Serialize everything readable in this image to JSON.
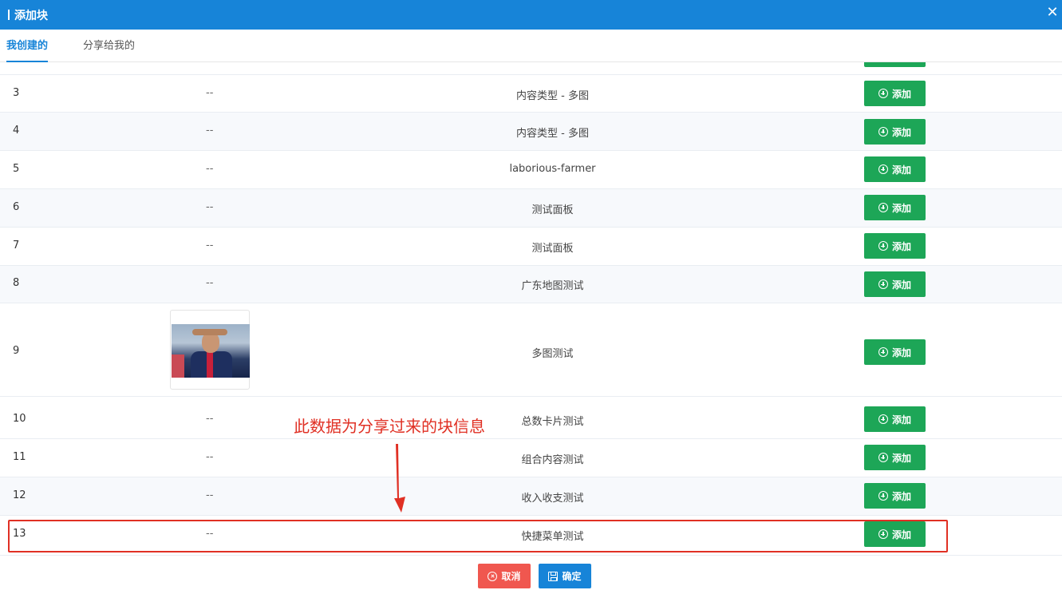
{
  "dialog": {
    "title": "添加块",
    "close_icon": "close-icon",
    "tabs": [
      {
        "label": "我创建的",
        "active": true
      },
      {
        "label": "分享给我的",
        "active": false
      }
    ]
  },
  "table": {
    "add_label": "添加",
    "rows": [
      {
        "index": "3",
        "thumb": "--",
        "name": "内容类型 - 多图"
      },
      {
        "index": "4",
        "thumb": "--",
        "name": "内容类型 - 多图"
      },
      {
        "index": "5",
        "thumb": "--",
        "name": "laborious-farmer"
      },
      {
        "index": "6",
        "thumb": "--",
        "name": "测试面板"
      },
      {
        "index": "7",
        "thumb": "--",
        "name": "测试面板"
      },
      {
        "index": "8",
        "thumb": "--",
        "name": "广东地图测试"
      },
      {
        "index": "9",
        "thumb": "image",
        "name": "多图测试"
      },
      {
        "index": "10",
        "thumb": "--",
        "name": "总数卡片测试"
      },
      {
        "index": "11",
        "thumb": "--",
        "name": "组合内容测试"
      },
      {
        "index": "12",
        "thumb": "--",
        "name": "收入收支测试"
      },
      {
        "index": "13",
        "thumb": "--",
        "name": "快捷菜单测试"
      }
    ]
  },
  "annotation": {
    "text": "此数据为分享过来的块信息",
    "color": "#e03024"
  },
  "footer": {
    "cancel_label": "取消",
    "ok_label": "确定"
  },
  "colors": {
    "header": "#1784d8",
    "add_button": "#1da657",
    "cancel_button": "#f0574f",
    "ok_button": "#1784d8"
  }
}
